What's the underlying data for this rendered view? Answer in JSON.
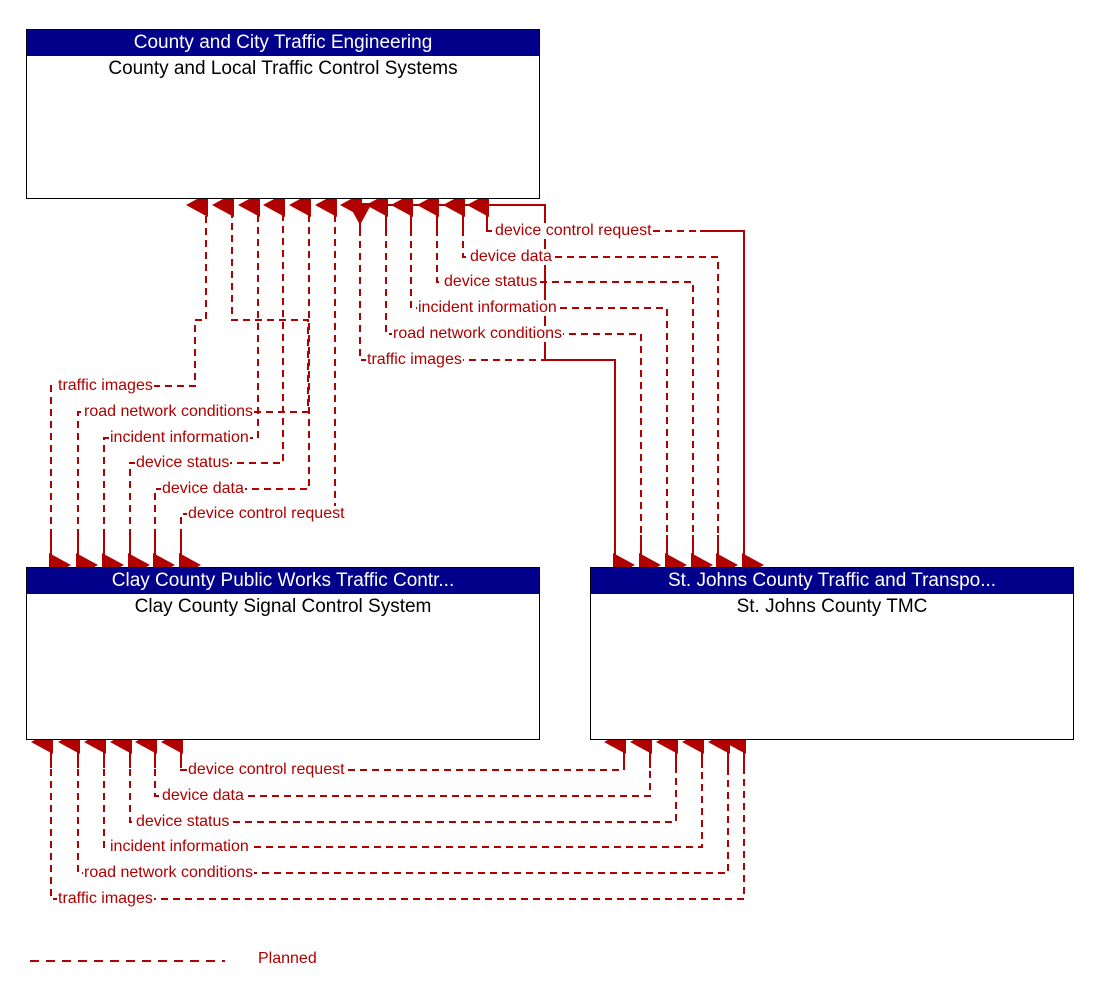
{
  "diagram": {
    "type": "architecture-interface-flow",
    "accent_color": "#B00000",
    "box_header_color": "#00008B",
    "elements": [
      {
        "id": "county-local",
        "stakeholder": "County and City Traffic Engineering",
        "system": "County and Local Traffic Control Systems"
      },
      {
        "id": "clay-signal",
        "stakeholder": "Clay County Public Works Traffic Contr...",
        "system": "Clay County Signal Control System"
      },
      {
        "id": "stjohns-tmc",
        "stakeholder": "St. Johns County Traffic and Transpo...",
        "system": "St. Johns County TMC"
      }
    ],
    "flows": {
      "top_right_group": [
        "device control request",
        "device data",
        "device status",
        "incident information",
        "road network conditions",
        "traffic images"
      ],
      "top_left_group": [
        "traffic images",
        "road network conditions",
        "incident information",
        "device status",
        "device data",
        "device control request"
      ],
      "bottom_group": [
        "device control request",
        "device data",
        "device status",
        "incident information",
        "road network conditions",
        "traffic images"
      ]
    },
    "legend": {
      "style": "dashed",
      "label": "Planned"
    }
  }
}
